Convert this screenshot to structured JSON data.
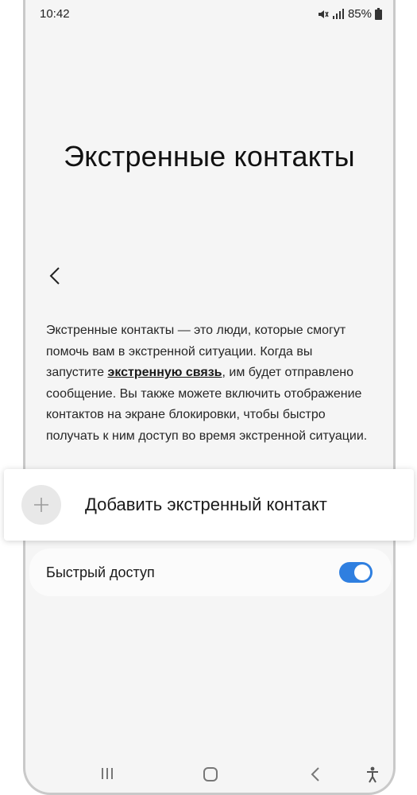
{
  "status_bar": {
    "time": "10:42",
    "battery": "85%"
  },
  "page": {
    "title": "Экстренные контакты"
  },
  "description": {
    "part1": "Экстренные контакты — это люди, которые смогут помочь вам в экстренной ситуации. Когда вы запустите ",
    "link": "экстренную связь",
    "part2": ", им будет отправлено сообщение. Вы также можете включить отображение контактов на экране блокировки, чтобы быстро получать к ним доступ во время экстренной ситуации."
  },
  "add_contact": {
    "label": "Добавить экстренный контакт"
  },
  "quick_access": {
    "label": "Быстрый доступ",
    "enabled": true
  },
  "colors": {
    "accent": "#2f7fe0",
    "background": "#f5f5f5"
  },
  "icons": {
    "back": "chevron-left-icon",
    "add": "plus-icon",
    "mute": "mute-icon",
    "signal": "signal-icon",
    "battery": "battery-icon",
    "nav_recents": "recents-icon",
    "nav_home": "home-icon",
    "nav_back": "back-icon",
    "accessibility": "accessibility-icon"
  }
}
